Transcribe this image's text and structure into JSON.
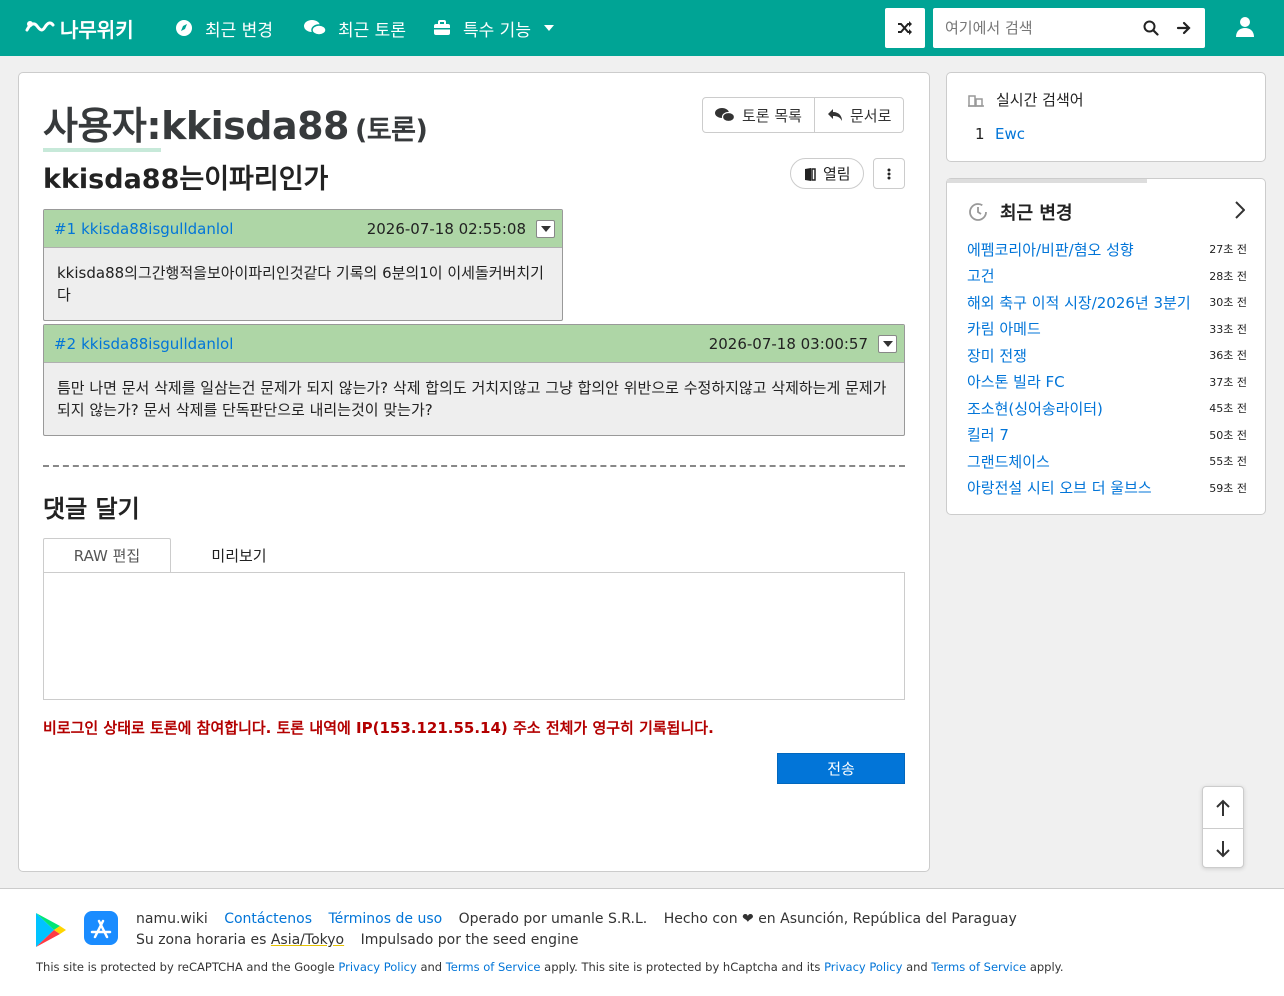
{
  "nav": {
    "logo": "나무위키",
    "recent_changes": "최근 변경",
    "recent_discuss": "최근 토론",
    "special": "특수 기능",
    "search_placeholder": "여기에서 검색"
  },
  "page": {
    "title_prefix": "사용자:",
    "title_name": "kkisda88",
    "title_suffix": "(토론)",
    "btn_discuss_list": "토론 목록",
    "btn_to_doc": "문서로",
    "topic": "kkisda88는이파리인가",
    "status": "열림"
  },
  "comments": [
    {
      "num": "#1",
      "author": "kkisda88isgulldanlol",
      "time": "2026-07-18 02:55:08",
      "body": "kkisda88의그간행적을보아이파리인것같다 기록의 6분의1이 이세돌커버치기다"
    },
    {
      "num": "#2",
      "author": "kkisda88isgulldanlol",
      "time": "2026-07-18 03:00:57",
      "body": "틈만 나면 문서 삭제를 일삼는건 문제가 되지 않는가? 삭제 합의도 거치지않고 그냥 합의안 위반으로 수정하지않고 삭제하는게 문제가 되지 않는가? 문서 삭제를 단독판단으로 내리는것이 맞는가?"
    }
  ],
  "reply": {
    "title": "댓글 달기",
    "tab_raw": "RAW 편집",
    "tab_preview": "미리보기",
    "editor_value": "",
    "warning": "비로그인 상태로 토론에 참여합니다. 토론 내역에 IP(153.121.55.14) 주소 전체가 영구히 기록됩니다.",
    "submit": "전송"
  },
  "sidebar": {
    "live_title": "실시간 검색어",
    "live_items": [
      {
        "rank": "1",
        "keyword": "Ewc"
      }
    ],
    "recent_title": "최근 변경",
    "recent_items": [
      {
        "title": "에펨코리아/비판/혐오 성향",
        "ago": "27초 전"
      },
      {
        "title": "고건",
        "ago": "28초 전"
      },
      {
        "title": "해외 축구 이적 시장/2026년 3분기",
        "ago": "30초 전"
      },
      {
        "title": "카림 아메드",
        "ago": "33초 전"
      },
      {
        "title": "장미 전쟁",
        "ago": "36초 전"
      },
      {
        "title": "아스톤 빌라 FC",
        "ago": "37초 전"
      },
      {
        "title": "조소현(싱어송라이터)",
        "ago": "45초 전"
      },
      {
        "title": "킬러 7",
        "ago": "50초 전"
      },
      {
        "title": "그랜드체이스",
        "ago": "55초 전"
      },
      {
        "title": "아랑전설 시티 오브 더 울브스",
        "ago": "59초 전"
      }
    ]
  },
  "footer": {
    "site": "namu.wiki",
    "contact": "Contáctenos",
    "terms": "Términos de uso",
    "operated": "Operado por umanle S.R.L.",
    "made": "Hecho con ❤ en Asunción, República del Paraguay",
    "tz_label": "Su zona horaria es",
    "tz": "Asia/Tokyo",
    "engine": "Impulsado por the seed engine",
    "recaptcha_1": "This site is protected by reCAPTCHA and the Google",
    "privacy": "Privacy Policy",
    "and": "and",
    "tos": "Terms of Service",
    "apply": "apply.",
    "hcaptcha_1": "This site is protected by hCaptcha and its"
  },
  "colors": {
    "brand": "#00a495",
    "link": "#0275d8",
    "comment_head": "#aed6a6",
    "warning": "#b30000"
  }
}
